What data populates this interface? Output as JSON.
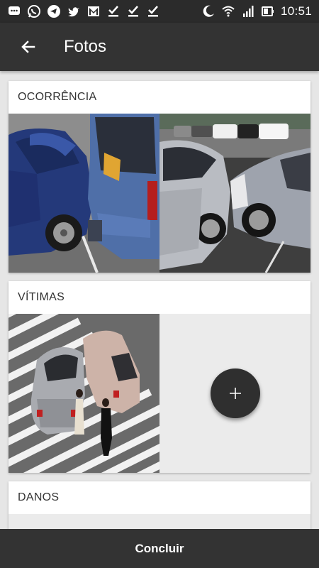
{
  "status_bar": {
    "time": "10:51",
    "icons": [
      "chat-bubble-icon",
      "whatsapp-icon",
      "telegram-icon",
      "twitter-icon",
      "gmail-icon",
      "check-icon",
      "check-icon",
      "check-icon",
      "moon-icon",
      "wifi-icon",
      "signal-icon",
      "battery-icon"
    ]
  },
  "app_bar": {
    "title": "Fotos",
    "back_icon": "arrow-back-icon"
  },
  "sections": [
    {
      "title": "OCORRÊNCIA",
      "photos": [
        "blue-car-crash-photo",
        "silver-cars-collision-photo"
      ]
    },
    {
      "title": "VÍTIMAS",
      "photos": [
        "crosswalk-accident-photo"
      ],
      "add_button_icon": "plus-icon"
    },
    {
      "title": "DANOS",
      "photos": []
    }
  ],
  "bottom_bar": {
    "label": "Concluir"
  },
  "colors": {
    "app_bar": "#333333",
    "status_bar": "#2b2b2b",
    "background": "#e6e6e6",
    "fab": "#2f2f2f"
  }
}
